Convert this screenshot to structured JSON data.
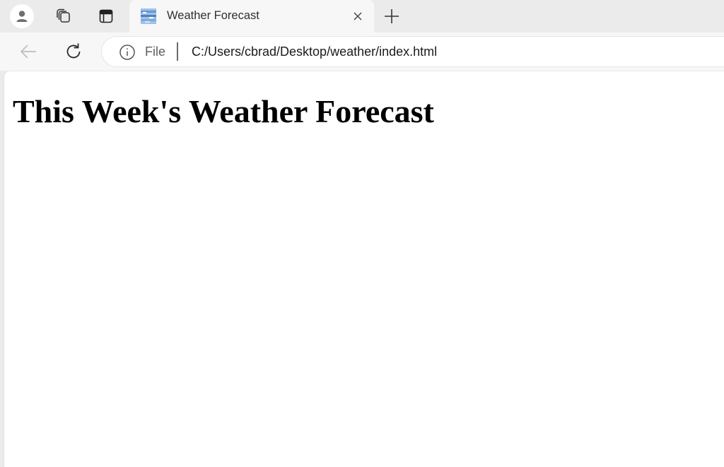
{
  "browser": {
    "tabs": [
      {
        "title": "Weather Forecast",
        "active": true
      }
    ],
    "address_bar": {
      "scheme_label": "File",
      "url": "C:/Users/cbrad/Desktop/weather/index.html"
    },
    "icons": {
      "profile": "person-icon",
      "workspaces": "workspaces-icon",
      "vertical_tabs": "vertical-tabs-icon",
      "favicon": "weather-favicon",
      "close_tab": "close-icon",
      "new_tab": "plus-icon",
      "back": "back-arrow-icon",
      "reload": "reload-icon",
      "site_info": "info-icon"
    },
    "colors": {
      "tab_strip": "#ebebeb",
      "toolbar": "#f7f7f7",
      "page_background": "#ffffff"
    }
  },
  "page": {
    "heading": "This Week's Weather Forecast"
  }
}
